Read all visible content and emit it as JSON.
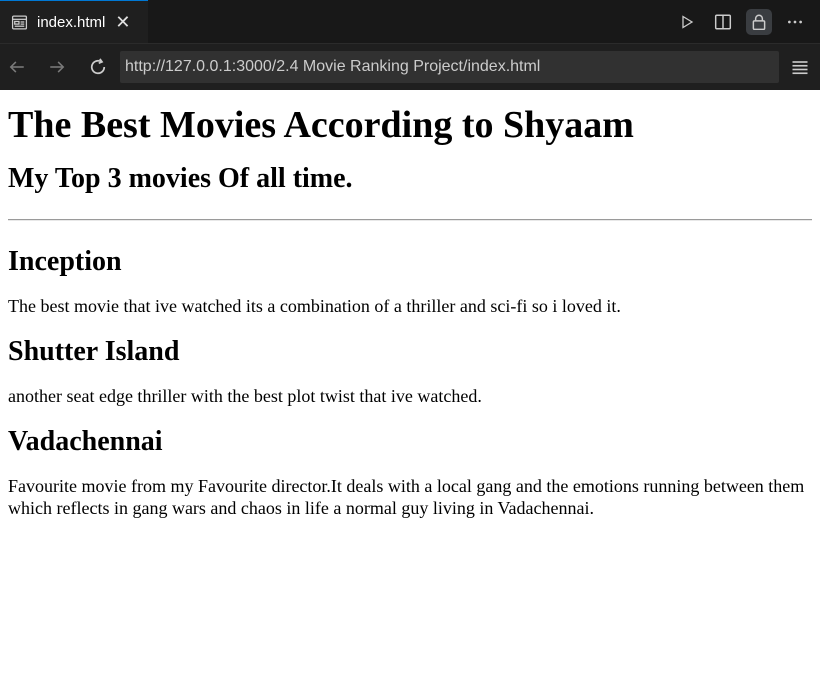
{
  "tab": {
    "title": "index.html",
    "close_glyph": "✕"
  },
  "toolbar": {
    "url": "http://127.0.0.1:3000/2.4 Movie Ranking Project/index.html"
  },
  "page": {
    "heading": "The Best Movies According to Shyaam",
    "subheading": "My Top 3 movies Of all time.",
    "movies": [
      {
        "title": "Inception",
        "description": "The best movie that ive watched its a combination of a thriller and sci-fi so i loved it."
      },
      {
        "title": "Shutter Island",
        "description": "another seat edge thriller with the best plot twist that ive watched."
      },
      {
        "title": "Vadachennai",
        "description": "Favourite movie from my Favourite director.It deals with a local gang and the emotions running between them which reflects in gang wars and chaos in life a normal guy living in Vadachennai."
      }
    ]
  },
  "icons": {
    "tab": "preview-file-icon",
    "actions": [
      "run-icon",
      "split-editor-icon",
      "lock-icon",
      "more-icon"
    ],
    "nav": [
      "back-arrow-icon",
      "forward-arrow-icon",
      "reload-icon",
      "menu-icon"
    ]
  },
  "colors": {
    "tab_accent": "#0078d4",
    "editor_bg": "#181818",
    "toolbar_bg": "#1f1f1f",
    "url_bg": "#313131"
  }
}
